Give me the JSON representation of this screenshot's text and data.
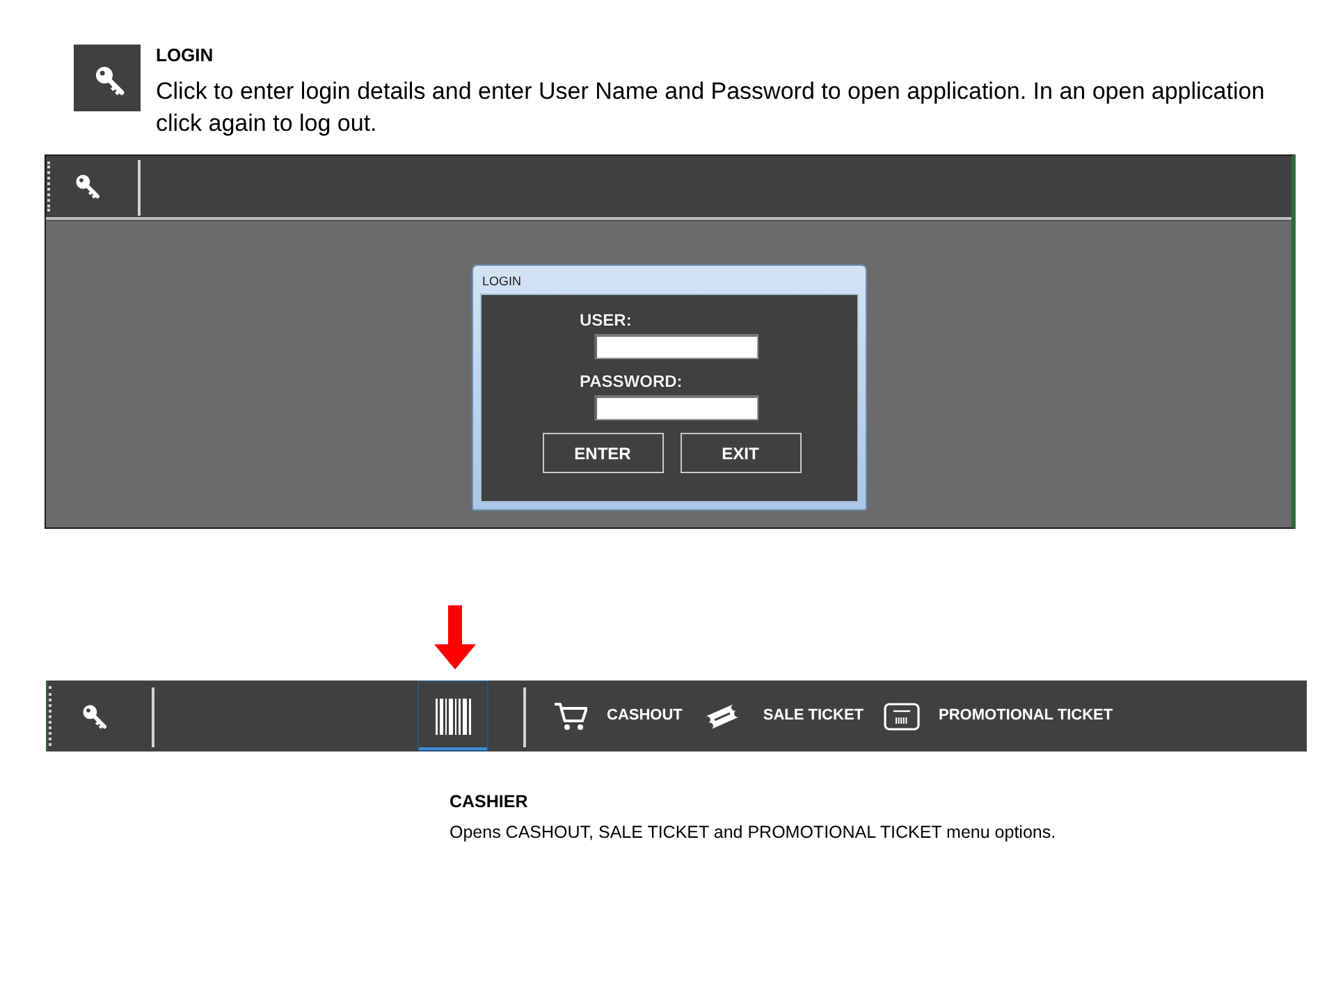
{
  "login_help": {
    "title": "LOGIN",
    "description": "Click to enter login details and enter User Name and Password to open application. In an open application click again to log out."
  },
  "login_screen": {
    "toolbar": {
      "buttons": [
        {
          "kind": "key"
        }
      ]
    },
    "dialog": {
      "title": "LOGIN",
      "fields": [
        {
          "label": "USER:"
        },
        {
          "label": "PASSWORD:"
        }
      ],
      "buttons": [
        "ENTER",
        "EXIT"
      ]
    }
  },
  "cashier_toolbar": {
    "buttons": [
      {
        "kind": "key",
        "selected": false
      },
      {
        "kind": "barcode",
        "selected": true
      }
    ],
    "menu_items": [
      {
        "kind": "cart",
        "label": "CASHOUT"
      },
      {
        "kind": "ticket",
        "label": "SALE TICKET"
      },
      {
        "kind": "coupon",
        "label": "PROMOTIONAL TICKET"
      }
    ]
  },
  "cashier_help": {
    "title": "CASHIER",
    "description": "Opens CASHOUT, SALE TICKET and PROMOTIONAL TICKET menu options."
  }
}
